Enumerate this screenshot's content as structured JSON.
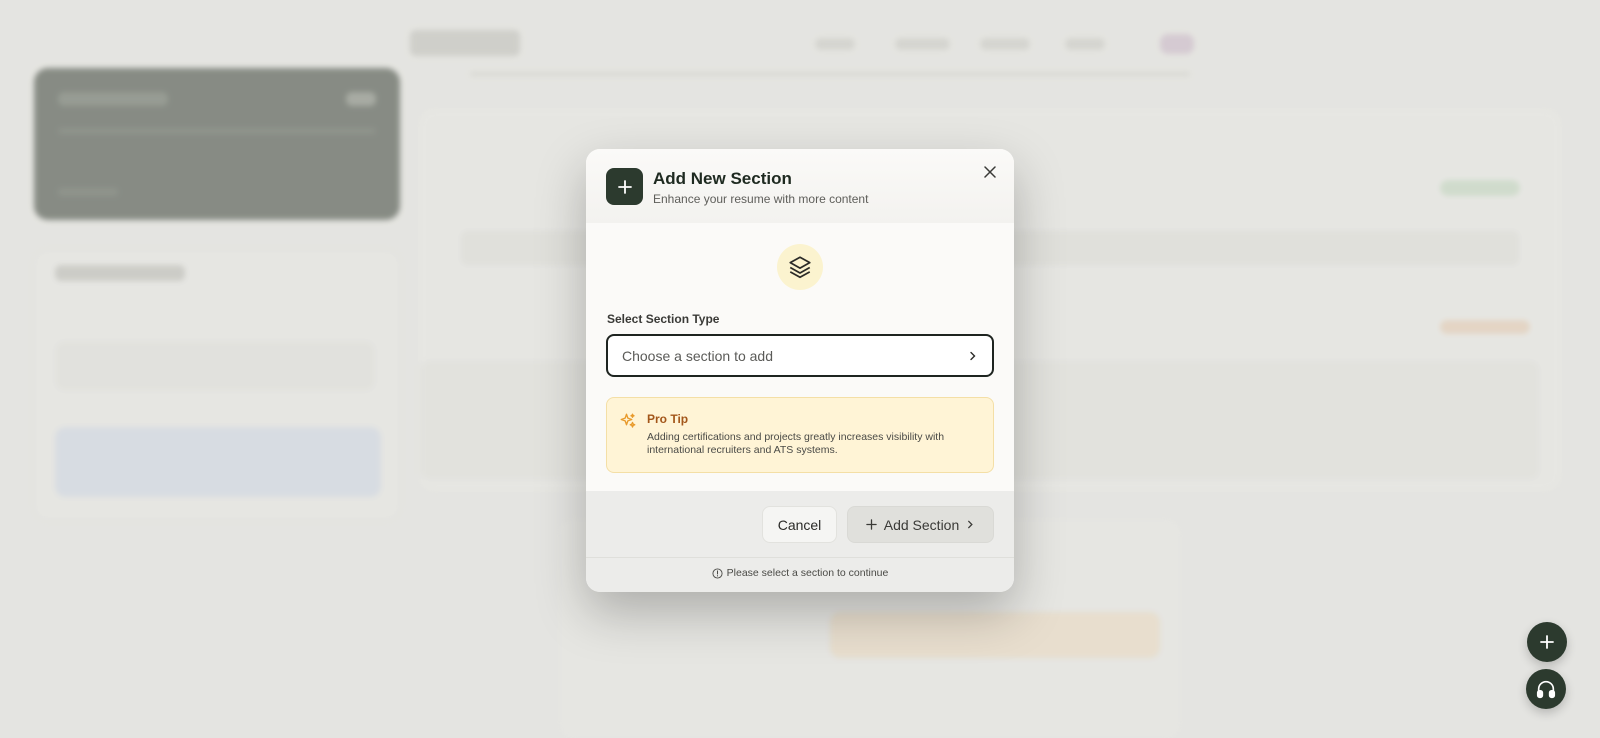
{
  "modal": {
    "title": "Add New Section",
    "subtitle": "Enhance your resume with more content",
    "close_icon": "close-icon",
    "header_icon": "plus-icon",
    "illustration_icon": "layers-icon"
  },
  "section_select": {
    "label": "Select Section Type",
    "placeholder": "Choose a section to add",
    "chevron_icon": "chevron-right-icon"
  },
  "pro_tip": {
    "icon": "sparkles-icon",
    "title": "Pro Tip",
    "text": "Adding certifications and projects greatly increases visibility with international recruiters and ATS systems."
  },
  "actions": {
    "cancel_label": "Cancel",
    "add_label": "Add Section"
  },
  "footer_note": "Please select a section to continue",
  "fabs": {
    "add_icon": "plus-icon",
    "support_icon": "headphones-icon"
  },
  "colors": {
    "primary": "#2c3a2e",
    "tip_background": "#fff4d6",
    "tip_title": "#a3561a",
    "illustration_background": "#fbf3cf"
  }
}
